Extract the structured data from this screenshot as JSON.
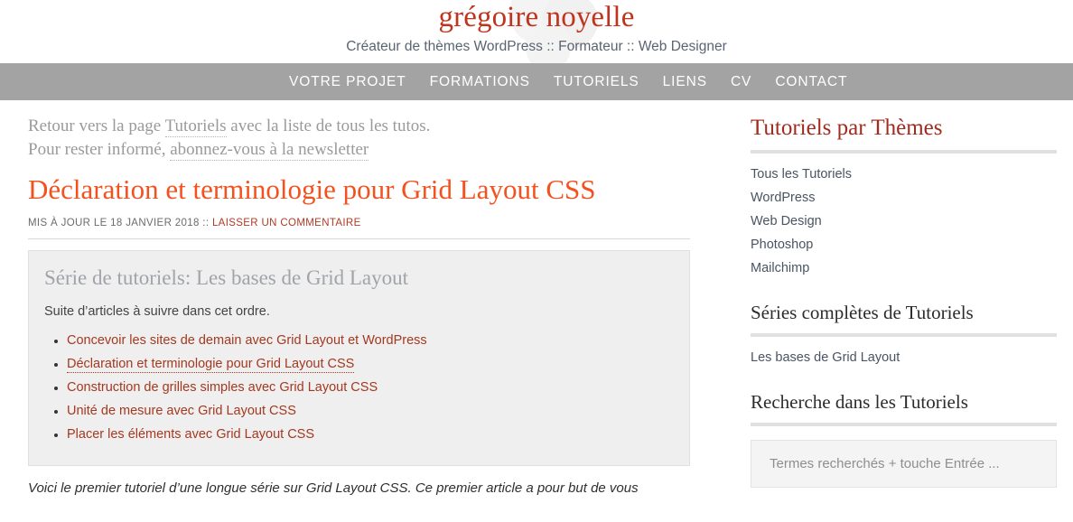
{
  "header": {
    "site_title": "grégoire noyelle",
    "tagline": "Créateur de thèmes WordPress :: Formateur :: Web Designer"
  },
  "nav": {
    "items": [
      {
        "label": "VOTRE PROJET"
      },
      {
        "label": "FORMATIONS"
      },
      {
        "label": "TUTORIELS"
      },
      {
        "label": "LIENS"
      },
      {
        "label": "CV"
      },
      {
        "label": "CONTACT"
      }
    ]
  },
  "intro": {
    "line1_before": "Retour vers la page ",
    "line1_link": "Tutoriels",
    "line1_after": " avec la liste de tous les tutos.",
    "line2_before": "Pour rester informé, ",
    "line2_link": "abonnez-vous à la newsletter"
  },
  "article": {
    "title": "Déclaration et terminologie pour Grid Layout CSS",
    "meta_date": "MIS À JOUR LE 18 JANVIER 2018 ::",
    "meta_comment_link": "LAISSER UN COMMENTAIRE",
    "lead": "Voici le premier tutoriel d’une longue série sur Grid Layout CSS. Ce premier article a pour but de vous"
  },
  "series_box": {
    "title": "Série de tutoriels: Les bases de Grid Layout",
    "intro": "Suite d’articles à suivre dans cet ordre.",
    "items": [
      {
        "label": "Concevoir les sites de demain avec Grid Layout et WordPress",
        "current": false
      },
      {
        "label": "Déclaration et terminologie pour Grid Layout CSS",
        "current": true
      },
      {
        "label": "Construction de grilles simples avec Grid Layout CSS",
        "current": false
      },
      {
        "label": "Unité de mesure avec Grid Layout CSS",
        "current": false
      },
      {
        "label": "Placer les éléments avec Grid Layout CSS",
        "current": false
      }
    ]
  },
  "sidebar": {
    "widgets": [
      {
        "title": "Tutoriels par Thèmes",
        "items": [
          {
            "label": "Tous les Tutoriels"
          },
          {
            "label": "WordPress"
          },
          {
            "label": "Web Design"
          },
          {
            "label": "Photoshop"
          },
          {
            "label": "Mailchimp"
          }
        ]
      },
      {
        "title": "Séries complètes de Tutoriels",
        "items": [
          {
            "label": "Les bases de Grid Layout"
          }
        ]
      },
      {
        "title": "Recherche dans les Tutoriels",
        "items": []
      }
    ],
    "search": {
      "placeholder": "Termes recherchés + touche Entrée ...",
      "value": ""
    }
  },
  "colors": {
    "site_title": "#c0341d",
    "entry_title": "#f4511e",
    "nav_bar": "#a3a3a3",
    "widget_accent": "#a02c1f",
    "link_red": "#a5381f"
  }
}
